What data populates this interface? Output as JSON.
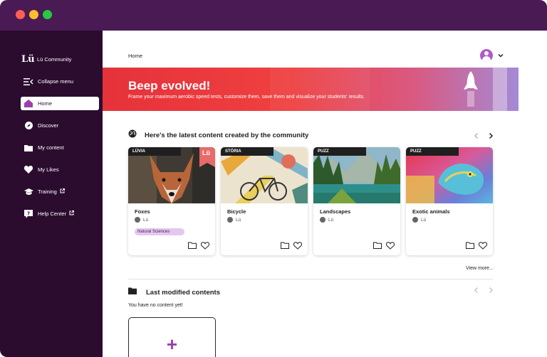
{
  "window": {
    "controls": [
      "close-dot",
      "minimize-dot",
      "maximize-dot"
    ]
  },
  "sidebar": {
    "brand_logo": "Lü",
    "brand_name": "Lü Community",
    "items": [
      {
        "label": "Collapse menu",
        "icon": "collapse-icon"
      },
      {
        "label": "Home",
        "icon": "home-icon",
        "active": true
      },
      {
        "label": "Discover",
        "icon": "compass-icon"
      },
      {
        "label": "My content",
        "icon": "folder-icon"
      },
      {
        "label": "My Likes",
        "icon": "heart-icon"
      },
      {
        "label": "Training",
        "icon": "graduation-cap-icon",
        "external": true
      },
      {
        "label": "Help Center",
        "icon": "help-icon",
        "external": true
      }
    ]
  },
  "header": {
    "breadcrumb": "Home",
    "avatar_icon": "user-avatar-icon",
    "dropdown_icon": "chevron-down-icon"
  },
  "banner": {
    "title": "Beep evolved!",
    "subtitle": "Frame your maximum aerobic speed tests, customize them, save them and visualize your students' results.",
    "icon": "rocket-icon"
  },
  "community": {
    "title": "Here's the latest content created by the community",
    "icon": "globe-icon",
    "view_more": "View more...",
    "cards": [
      {
        "tag": "LÜVIA",
        "name": "Foxes",
        "author": "Lü",
        "chip": "Natural Sciences",
        "badge": "Lü"
      },
      {
        "tag": "STÖRIA",
        "name": "Bicycle",
        "author": "Lü"
      },
      {
        "tag": "PUZZ",
        "name": "Landscapes",
        "author": "Lü"
      },
      {
        "tag": "PUZZ",
        "name": "Exotic animals",
        "author": "Lü"
      }
    ]
  },
  "modified": {
    "title": "Last modified contents",
    "icon": "folder-icon",
    "empty": "You have no content yet!",
    "add_label": "+"
  },
  "colors": {
    "accent": "#9b3fb0",
    "sidebar": "#2b0c2f",
    "titlebar": "#4a1a55",
    "chip": "#e4c8ef"
  }
}
